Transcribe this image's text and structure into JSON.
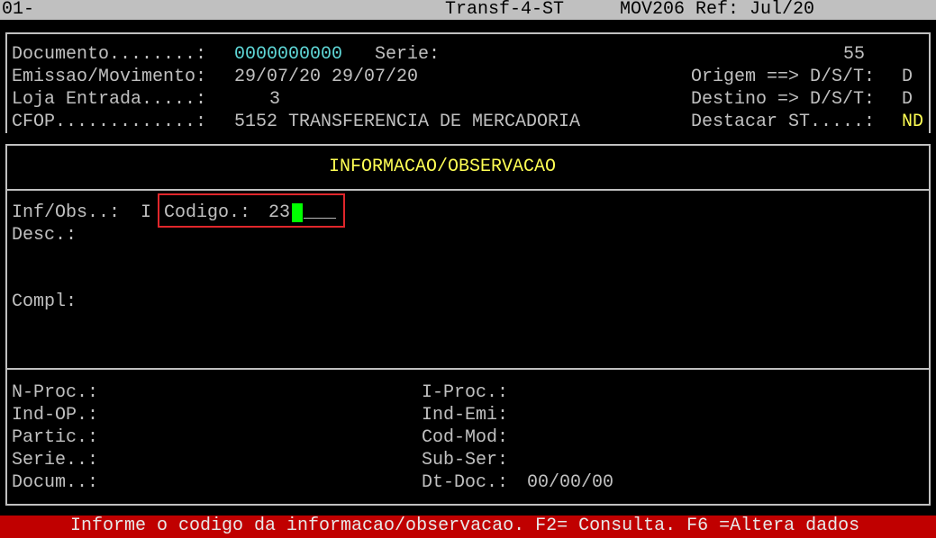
{
  "topbar": {
    "session": "01-",
    "program": "Transf-4-ST",
    "module": "MOV206 Ref: Jul/20"
  },
  "header": {
    "documento_label": "Documento........:",
    "documento_value": "0000000000",
    "serie_label": "Serie:",
    "serie_value": "55",
    "emissao_label": "Emissao/Movimento:",
    "emissao_value": "29/07/20 29/07/20",
    "origem_label": "Origem ==> D/S/T:",
    "origem_value": "D",
    "loja_label": "Loja Entrada.....:",
    "loja_value": "3",
    "destino_label": "Destino => D/S/T:",
    "destino_value": "D",
    "cfop_label": "CFOP.............:",
    "cfop_value": "5152 TRANSFERENCIA DE MERCADORIA",
    "destacar_label": "Destacar ST.....:",
    "destacar_value": "ND"
  },
  "info": {
    "title": "INFORMACAO/OBSERVACAO",
    "infobs_label": "Inf/Obs..:",
    "infobs_value": "I",
    "codigo_label": "Codigo.:",
    "codigo_value": "23",
    "codigo_blank": "___",
    "desc_label": "Desc.:",
    "compl_label": "Compl:"
  },
  "details": {
    "nproc_label": "N-Proc.:",
    "iproc_label": "I-Proc.:",
    "indop_label": "Ind-OP.:",
    "indemi_label": "Ind-Emi:",
    "partic_label": "Partic.:",
    "codmod_label": "Cod-Mod:",
    "serie_label": "Serie..:",
    "subser_label": "Sub-Ser:",
    "docum_label": "Docum..:",
    "dtdoc_label": "Dt-Doc.:",
    "dtdoc_value": "00/00/00"
  },
  "status_message": "Informe o codigo da informacao/observacao. F2= Consulta. F6 =Altera dados",
  "colors": {
    "background": "#000000",
    "text": "#c0c0c0",
    "cyan_value": "#5fd7d7",
    "yellow_value": "#ffff54",
    "highlight": "#e0262b",
    "cursor": "#00ff00",
    "message_bar": "#c00000"
  }
}
